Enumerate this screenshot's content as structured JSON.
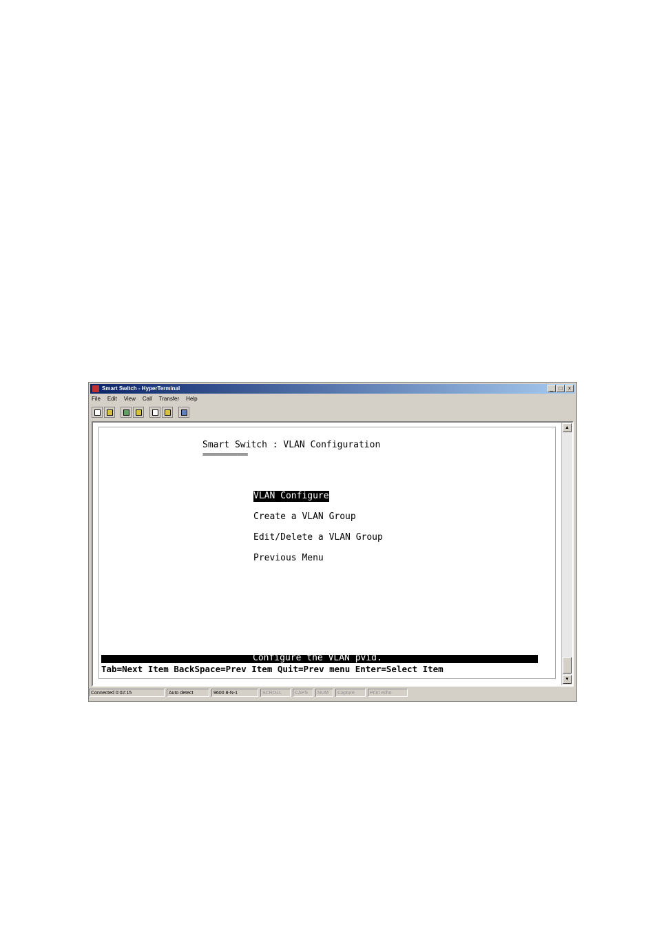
{
  "window": {
    "title": "Smart Switch - HyperTerminal",
    "controls": [
      "_",
      "□",
      "×"
    ]
  },
  "menu": [
    "File",
    "Edit",
    "View",
    "Call",
    "Transfer",
    "Help"
  ],
  "toolbar": {
    "icons": [
      "new-document-icon",
      "open-icon",
      "dial-icon",
      "disconnect-icon",
      "send-icon",
      "receive-icon",
      "properties-icon"
    ]
  },
  "terminal": {
    "heading": "Smart Switch : VLAN Configuration",
    "underline": "=============",
    "menu_items": [
      {
        "label": "VLAN Configure",
        "selected": true
      },
      {
        "label": "Create a VLAN Group",
        "selected": false
      },
      {
        "label": "Edit/Delete a VLAN Group",
        "selected": false
      },
      {
        "label": "Previous Menu",
        "selected": false
      }
    ],
    "status_message": "Configure the VLAN pvid.",
    "help_line": "Tab=Next Item  BackSpace=Prev Item  Quit=Prev menu Enter=Select Item"
  },
  "statusbar": {
    "connected": "Connected 0:02:15",
    "detect": "Auto detect",
    "settings": "9600 8-N-1",
    "scroll": "SCROLL",
    "caps": "CAPS",
    "num": "NUM",
    "capture": "Capture",
    "print_echo": "Print echo"
  }
}
